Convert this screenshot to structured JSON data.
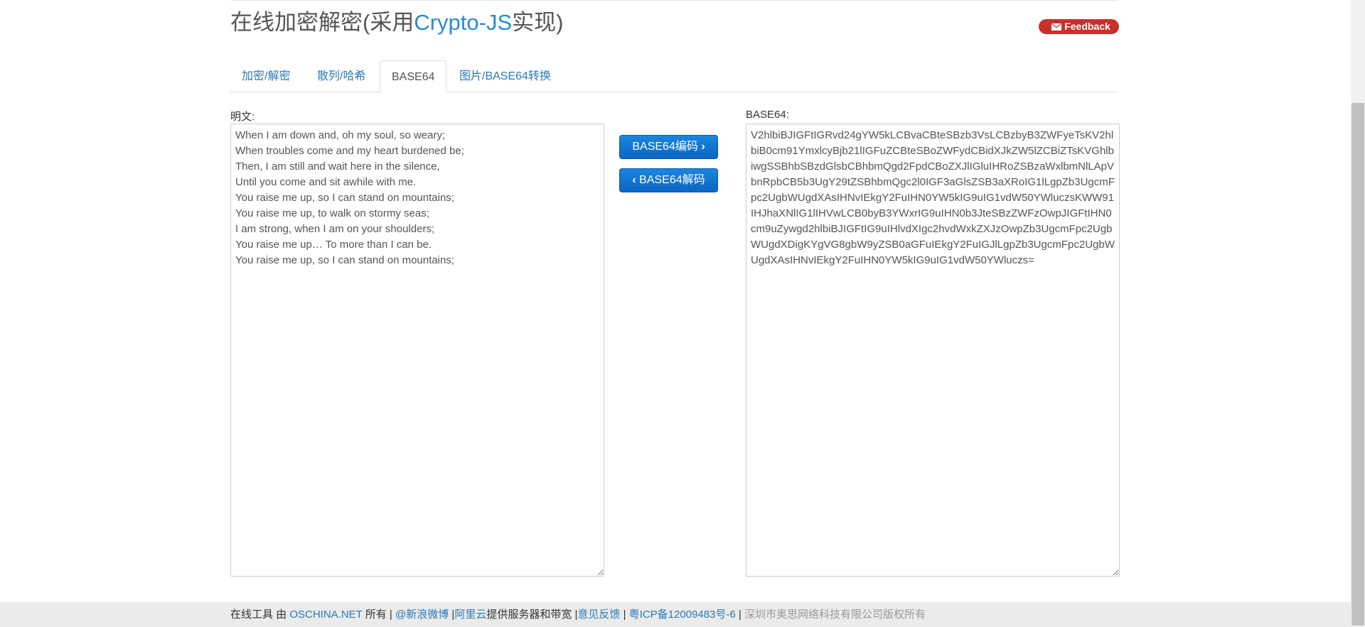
{
  "header": {
    "title_prefix": "在线加密解密(采用",
    "title_brand": "Crypto-JS",
    "title_suffix": "实现)",
    "feedback_label": "Feedback"
  },
  "tabs": [
    {
      "label": "加密/解密",
      "active": false
    },
    {
      "label": "散列/哈希",
      "active": false
    },
    {
      "label": "BASE64",
      "active": true
    },
    {
      "label": "图片/BASE64转换",
      "active": false
    }
  ],
  "plaintext": {
    "label": "明文:",
    "value": "When I am down and, oh my soul, so weary;\nWhen troubles come and my heart burdened be;\nThen, I am still and wait here in the silence,\nUntil you come and sit awhile with me.\nYou raise me up, so I can stand on mountains;\nYou raise me up, to walk on stormy seas;\nI am strong, when I am on your shoulders;\nYou raise me up… To more than I can be.\nYou raise me up, so I can stand on mountains;"
  },
  "actions": {
    "encode_label": "BASE64编码",
    "decode_label": "BASE64解码"
  },
  "base64": {
    "label": "BASE64:",
    "value": "V2hlbiBJIGFtIGRvd24gYW5kLCBvaCBteSBzb3VsLCBzbyB3ZWFyeTsKV2hlbiB0cm91YmxlcyBjb21lIGFuZCBteSBoZWFydCBidXJkZW5lZCBiZTsKVGhlbiwgSSBhbSBzdGlsbCBhbmQgd2FpdCBoZXJlIGluIHRoZSBzaWxlbmNlLApVbnRpbCB5b3UgY29tZSBhbmQgc2l0IGF3aGlsZSB3aXRoIG1lLgpZb3UgcmFpc2UgbWUgdXAsIHNvIEkgY2FuIHN0YW5kIG9uIG1vdW50YWluczsKWW91IHJhaXNlIG1lIHVwLCB0byB3YWxrIG9uIHN0b3JteSBzZWFzOwpJIGFtIHN0cm9uZywgd2hlbiBJIGFtIG9uIHlvdXIgc2hvdWxkZXJzOwpZb3UgcmFpc2UgbWUgdXDigKYgVG8gbW9yZSB0aGFuIEkgY2FuIGJlLgpZb3UgcmFpc2UgbWUgdXAsIHNvIEkgY2FuIHN0YW5kIG9uIG1vdW50YWluczs="
  },
  "footer": {
    "prefix": "在线工具 由 ",
    "oschina": "OSCHINA.NET",
    "owner": " 所有 | ",
    "weibo": "@新浪微博",
    "sep1": " |",
    "aliyun": "阿里云",
    "aliyun_text": "提供服务器和带宽 |",
    "feedback": "意见反馈",
    "sep2": " | ",
    "icp": "粤ICP备12009483号-6",
    "sep3": " | ",
    "copyright": "深圳市奥思网络科技有限公司版权所有"
  },
  "colors": {
    "brand_blue": "#2a8bd0",
    "button_blue": "#0a66c2",
    "feedback_red": "#c9302c"
  }
}
